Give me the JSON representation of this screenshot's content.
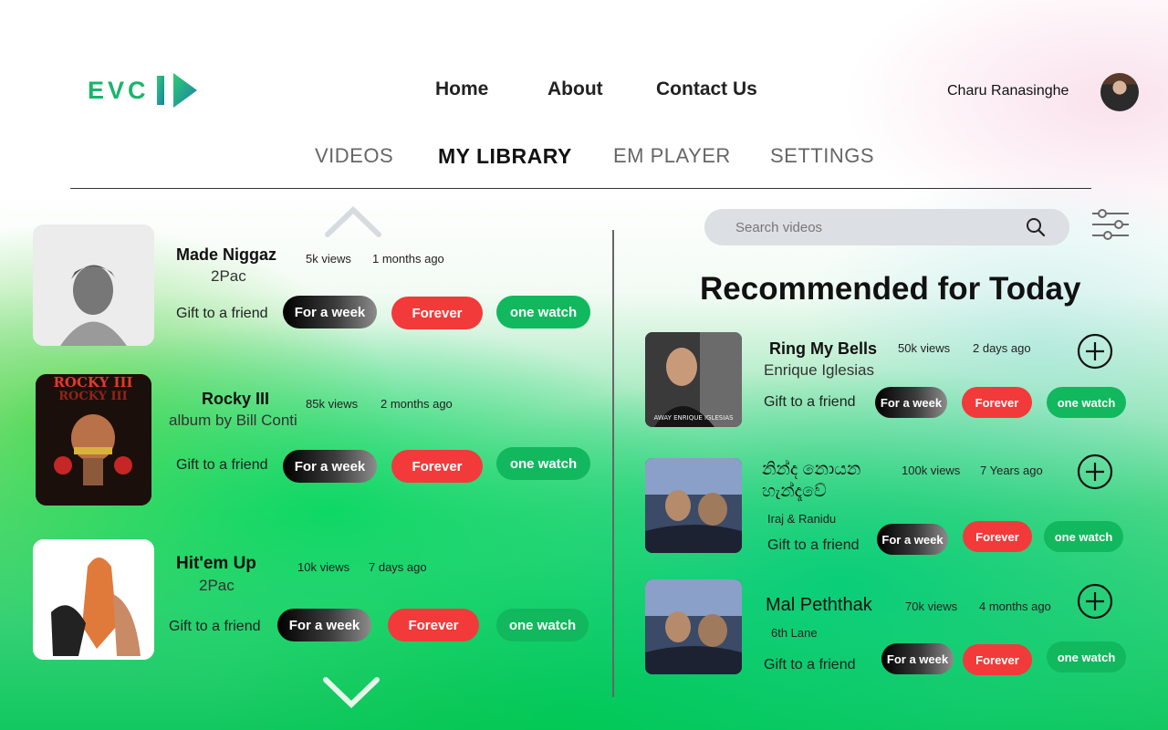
{
  "brand": {
    "logo_text": "EVC"
  },
  "nav": {
    "home": "Home",
    "about": "About",
    "contact": "Contact Us"
  },
  "user": {
    "name": "Charu Ranasinghe"
  },
  "tabs": {
    "videos": "VIDEOS",
    "my_library": "MY LIBRARY",
    "em_player": "EM PLAYER",
    "settings": "SETTINGS",
    "active": "MY LIBRARY"
  },
  "library": [
    {
      "title": "Made Niggaz",
      "artist": "2Pac",
      "views": "5k views",
      "ago": "1 months ago",
      "gift": "Gift to a friend",
      "week": "For a week",
      "forever": "Forever",
      "watch": "one watch"
    },
    {
      "title": "Rocky III",
      "artist": "album by Bill Conti",
      "views": "85k views",
      "ago": "2 months ago",
      "gift": "Gift to a friend",
      "week": "For a week",
      "forever": "Forever",
      "watch": "one watch",
      "thumb_text": "ROCKY III"
    },
    {
      "title": "Hit'em Up",
      "artist": "2Pac",
      "views": "10k views",
      "ago": "7 days ago",
      "gift": "Gift to a friend",
      "week": "For a week",
      "forever": "Forever",
      "watch": "one watch"
    }
  ],
  "search": {
    "placeholder": "Search videos"
  },
  "recommended": {
    "heading": "Recommended for Today",
    "items": [
      {
        "title": "Ring My Bells",
        "artist": "Enrique Iglesias",
        "views": "50k views",
        "ago": "2 days ago",
        "gift": "Gift to a friend",
        "week": "For a week",
        "forever": "Forever",
        "watch": "one watch",
        "thumb_text": "AWAY ENRIQUE IGLESIAS"
      },
      {
        "title": "නින්ද නොයන හැන්දෑවේ",
        "artist": "Iraj & Ranidu",
        "views": "100k views",
        "ago": "7 Years ago",
        "gift": "Gift to a friend",
        "week": "For a week",
        "forever": "Forever",
        "watch": "one watch"
      },
      {
        "title": "Mal Peththak",
        "artist": "6th Lane",
        "views": "70k views",
        "ago": "4 months ago",
        "gift": "Gift to a friend",
        "week": "For a week",
        "forever": "Forever",
        "watch": "one watch"
      }
    ]
  },
  "colors": {
    "brand_green": "#19b56b",
    "forever_red": "#f23a3a",
    "watch_green": "#11b85d",
    "search_bg": "#dcdfe3"
  },
  "icons": {
    "logo": "play-triangle-icon",
    "scroll_up": "chevron-up-icon",
    "scroll_down": "chevron-down-icon",
    "search": "search-icon",
    "filter": "sliders-icon",
    "add": "plus-circle-icon"
  }
}
